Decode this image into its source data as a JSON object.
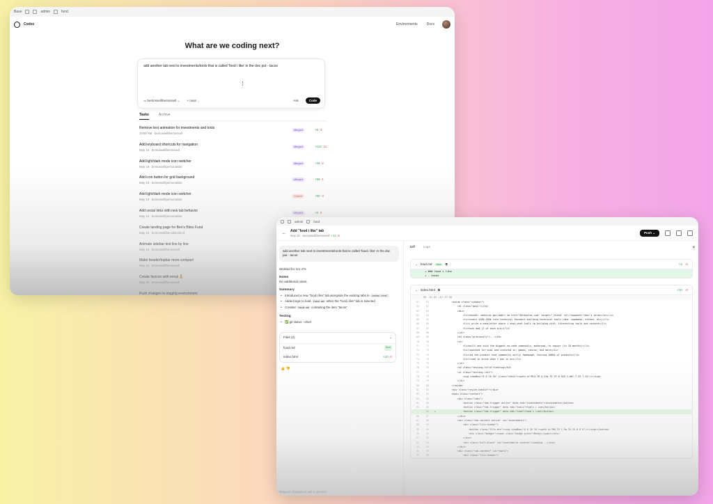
{
  "window1": {
    "chrome": {
      "label": "Base",
      "crumbs": [
        "admin",
        "fund"
      ]
    },
    "app_name": "Codex",
    "nav": [
      "Environments",
      "Docs"
    ],
    "headline": "What are we coding next?",
    "prompt": {
      "text": "add another tab next to investments/tools that is called 'food i like' in the doc put - tacos",
      "repo": "bentossell/bentossell",
      "branch": "main",
      "ask_label": "Ask",
      "code_label": "Code"
    },
    "tabs": [
      "Tasks",
      "Archive"
    ],
    "tasks": [
      {
        "title": "Remove text animation for investments and tools",
        "meta": "10:55 AM · bentossell/bentossell",
        "badge": "Merged",
        "badge_type": "merged",
        "plus": "+6",
        "minus": "-3"
      },
      {
        "title": "Add keyboard shortcuts for navigation",
        "meta": "May 19 · bentossell/bentossell",
        "badge": "Merged",
        "badge_type": "merged",
        "plus": "+112",
        "minus": "-11"
      },
      {
        "title": "Add light/dark mode icon switcher",
        "meta": "May 19 · bentossell/personalsite",
        "badge": "Merged",
        "badge_type": "merged",
        "plus": "+34",
        "minus": "-2"
      },
      {
        "title": "Add icon button for grid background",
        "meta": "May 19 · bentossell/personalsite",
        "badge": "Merged",
        "badge_type": "merged",
        "plus": "+56",
        "minus": "-1"
      },
      {
        "title": "Add light/dark mode icon switcher",
        "meta": "May 19 · bentossell/personalsite",
        "badge": "Closed",
        "badge_type": "closed",
        "plus": "+60",
        "minus": "-3"
      },
      {
        "title": "Add social links with new tab behavior",
        "meta": "May 19 · bentossell/personalsite",
        "badge": "Merged",
        "badge_type": "merged",
        "plus": "+8",
        "minus": "-0"
      },
      {
        "title": "Create landing page for Ben's Bites Fund",
        "meta": "May 19 · bentossell/bensbitesfund",
        "badge": "",
        "badge_type": "",
        "plus": "",
        "minus": ""
      },
      {
        "title": "Animate sidebar text line by line",
        "meta": "May 19 · bentossell/bentossell",
        "badge": "",
        "badge_type": "",
        "plus": "",
        "minus": ""
      },
      {
        "title": "Make header/topbar more compact",
        "meta": "May 19 · bentossell/bentossell",
        "badge": "",
        "badge_type": "",
        "plus": "",
        "minus": ""
      },
      {
        "title": "Create favicon with emoji 🧘",
        "meta": "May 19 · bentossell/bentossell",
        "badge": "",
        "badge_type": "",
        "plus": "",
        "minus": ""
      },
      {
        "title": "Push changes to staging environment",
        "meta": "",
        "badge": "",
        "badge_type": "",
        "plus": "",
        "minus": ""
      }
    ]
  },
  "window2": {
    "chrome": {
      "crumbs": [
        "admin",
        "fund"
      ]
    },
    "task_title": "Add \"food i like\" tab",
    "task_meta": "May 20 · bentossell/bentossell",
    "task_plus": "+12",
    "task_minus": "-0",
    "push_label": "Push",
    "user_message": "add another tab next to investments/tools that is called 'food i like' in the doc put - tacos",
    "worked_for": "Worked for 1m 47s",
    "notes_heading": "Notes",
    "notes_text": "No additional notes.",
    "summary_heading": "Summary",
    "summary_items": [
      {
        "pre": "Introduced a new \"food i like\" tab alongside the existing tabs in ",
        "code": "index.html",
        "post": ""
      },
      {
        "pre": "Added logic to load ",
        "code": "food.md",
        "post": " when the \"food i like\" tab is selected"
      },
      {
        "pre": "Created ",
        "code": "food.md",
        "post": " containing the item \"tacos\""
      }
    ],
    "testing_heading": "Testing",
    "testing_item": "✅ git status --short",
    "files_heading": "Files (2)",
    "files": [
      {
        "name": "food.md",
        "tag": "New",
        "plus": "",
        "minus": ""
      },
      {
        "name": "index.html",
        "tag": "",
        "plus": "+10",
        "minus": "-0"
      }
    ],
    "thumbs": "👍 👎",
    "bottom_placeholder": "Request changes or ask a question",
    "right_tabs": [
      "Diff",
      "Logs"
    ],
    "diff_files": [
      {
        "name": "food.md",
        "tag": "New",
        "plus": "+2",
        "minus": "-0",
        "lines": [
          "+ ### food i like",
          "+ - tacos"
        ]
      },
      {
        "name": "index.html",
        "tag": "",
        "plus": "+10",
        "minus": "-0",
        "hunk": "@@ -61,65 +61,75 @@"
      }
    ],
    "code_lines": [
      {
        "n1": "61",
        "n2": "61",
        "t": "            <aside class=\"sidebar\">",
        "add": false
      },
      {
        "n1": "62",
        "n2": "62",
        "t": "                <h1 class=\"main\"></h1>",
        "add": false
      },
      {
        "n1": "63",
        "n2": "63",
        "t": "                <div>",
        "add": false
      },
      {
        "n1": "64",
        "n2": "64",
        "t": "                    <li>founder <abbr>ai-go</abbr> no href=\"bensbites.com\" target=\"_blank\" rel=\"noopener\">ben's bites</a></li>",
        "add": false
      },
      {
        "n1": "65",
        "n2": "65",
        "t": "                    <li>invest $100-200k into technical founders building technical tools (aka: supabase, etched, etc)</li>",
        "add": false
      },
      {
        "n1": "66",
        "n2": "66",
        "t": "                    <li>i write a newsletter where i show what tools im building with, interesting tools and content</li>",
        "add": false
      },
      {
        "n1": "67",
        "n2": "67",
        "t": "                    <li>twin dad (1 of each b/w)</li>",
        "add": false
      },
      {
        "n1": "68",
        "n2": "68",
        "t": "                </ul>",
        "add": false
      },
      {
        "n1": "69",
        "n2": "69",
        "t": "                <h3 class=\"previously\">...</h3>",
        "add": false
      },
      {
        "n1": "70",
        "n2": "70",
        "t": "                <ul>",
        "add": false
      },
      {
        "n1": "71",
        "n2": "71",
        "t": "                    <li>built and sold the biggest no-code community, makerpad, to zapier (in 18 months)</li>",
        "add": false
      },
      {
        "n1": "72",
        "n2": "72",
        "t": "                    <li>launched for aibi and invested in; games, cosine, and more</li>",
        "add": false
      },
      {
        "n1": "73",
        "n2": "73",
        "t": "                    <li>led the product hunt community early: homepage, testing 1000s of products</li>",
        "add": false
      },
      {
        "n1": "74",
        "n2": "74",
        "t": "                    <li>lived in china when I was in uni</li>",
        "add": false
      },
      {
        "n1": "75",
        "n2": "75",
        "t": "                </ul>",
        "add": false
      },
      {
        "n1": "76",
        "n2": "76",
        "t": "                <h3 class=\"testing-title\">testing</h3>",
        "add": false
      },
      {
        "n1": "77",
        "n2": "77",
        "t": "                <ul class=\"testing-list\">",
        "add": false
      },
      {
        "n1": "78",
        "n2": "78",
        "t": "                    <svg viewBox=\"0 0 16 16\" class=\"check\"><path d=\"M13.78 4.22a.75.75 0 010 1.06l-7.25 7.25\"/></svg>",
        "add": false
      },
      {
        "n1": "79",
        "n2": "79",
        "t": "                </ul>",
        "add": false
      },
      {
        "n1": "80",
        "n2": "80",
        "t": "            </aside>",
        "add": false
      },
      {
        "n1": "81",
        "n2": "81",
        "t": "            <div class=\"resize-handle\"></div>",
        "add": false
      },
      {
        "n1": "82",
        "n2": "82",
        "t": "            <main class=\"content\">",
        "add": false
      },
      {
        "n1": "83",
        "n2": "83",
        "t": "                <div class=\"tabs\">",
        "add": false
      },
      {
        "n1": "84",
        "n2": "84",
        "t": "                    <button class=\"tab-trigger active\" data-tab=\"investments\">investments</button>",
        "add": false
      },
      {
        "n1": "85",
        "n2": "85",
        "t": "                    <button class=\"tab-trigger\" data-tab=\"tools\">tools i use</button>",
        "add": false
      },
      {
        "n1": "",
        "n2": "86",
        "t": "+                   <button class=\"tab-trigger\" data-tab=\"food\">food i like</button>",
        "add": true
      },
      {
        "n1": "86",
        "n2": "87",
        "t": "                </div>",
        "add": false
      },
      {
        "n1": "87",
        "n2": "88",
        "t": "                <div class=\"tab-content active\" id=\"investments\">",
        "add": false
      },
      {
        "n1": "88",
        "n2": "89",
        "t": "                    <div class=\"file-header\">",
        "add": false
      },
      {
        "n1": "89",
        "n2": "90",
        "t": "                        <button class=\"file-btn\"><svg viewBox=\"0 0 16 16\"><path d=\"M0.75 1.5a.25.25 0 0 0\"/></svg></button>",
        "add": false
      },
      {
        "n1": "90",
        "n2": "91",
        "t": "                        <div class=\"badges\"><span class=\"badge green\">Ready</span></div>",
        "add": false
      },
      {
        "n1": "91",
        "n2": "92",
        "t": "                    </div>",
        "add": false
      },
      {
        "n1": "92",
        "n2": "93",
        "t": "                    <div class=\"diff-block\" id=\"investments-content\">Loading...</div>",
        "add": false
      },
      {
        "n1": "93",
        "n2": "94",
        "t": "                </div>",
        "add": false
      },
      {
        "n1": "94",
        "n2": "95",
        "t": "                <div class=\"tab-content\" id=\"tools\">",
        "add": false
      },
      {
        "n1": "95",
        "n2": "96",
        "t": "                    <div class=\"file-header\">",
        "add": false
      }
    ]
  },
  "colors": {
    "accent": "#111111",
    "merged": "#7a4fd1",
    "closed": "#d24a4a",
    "added": "#2a9d4a"
  }
}
